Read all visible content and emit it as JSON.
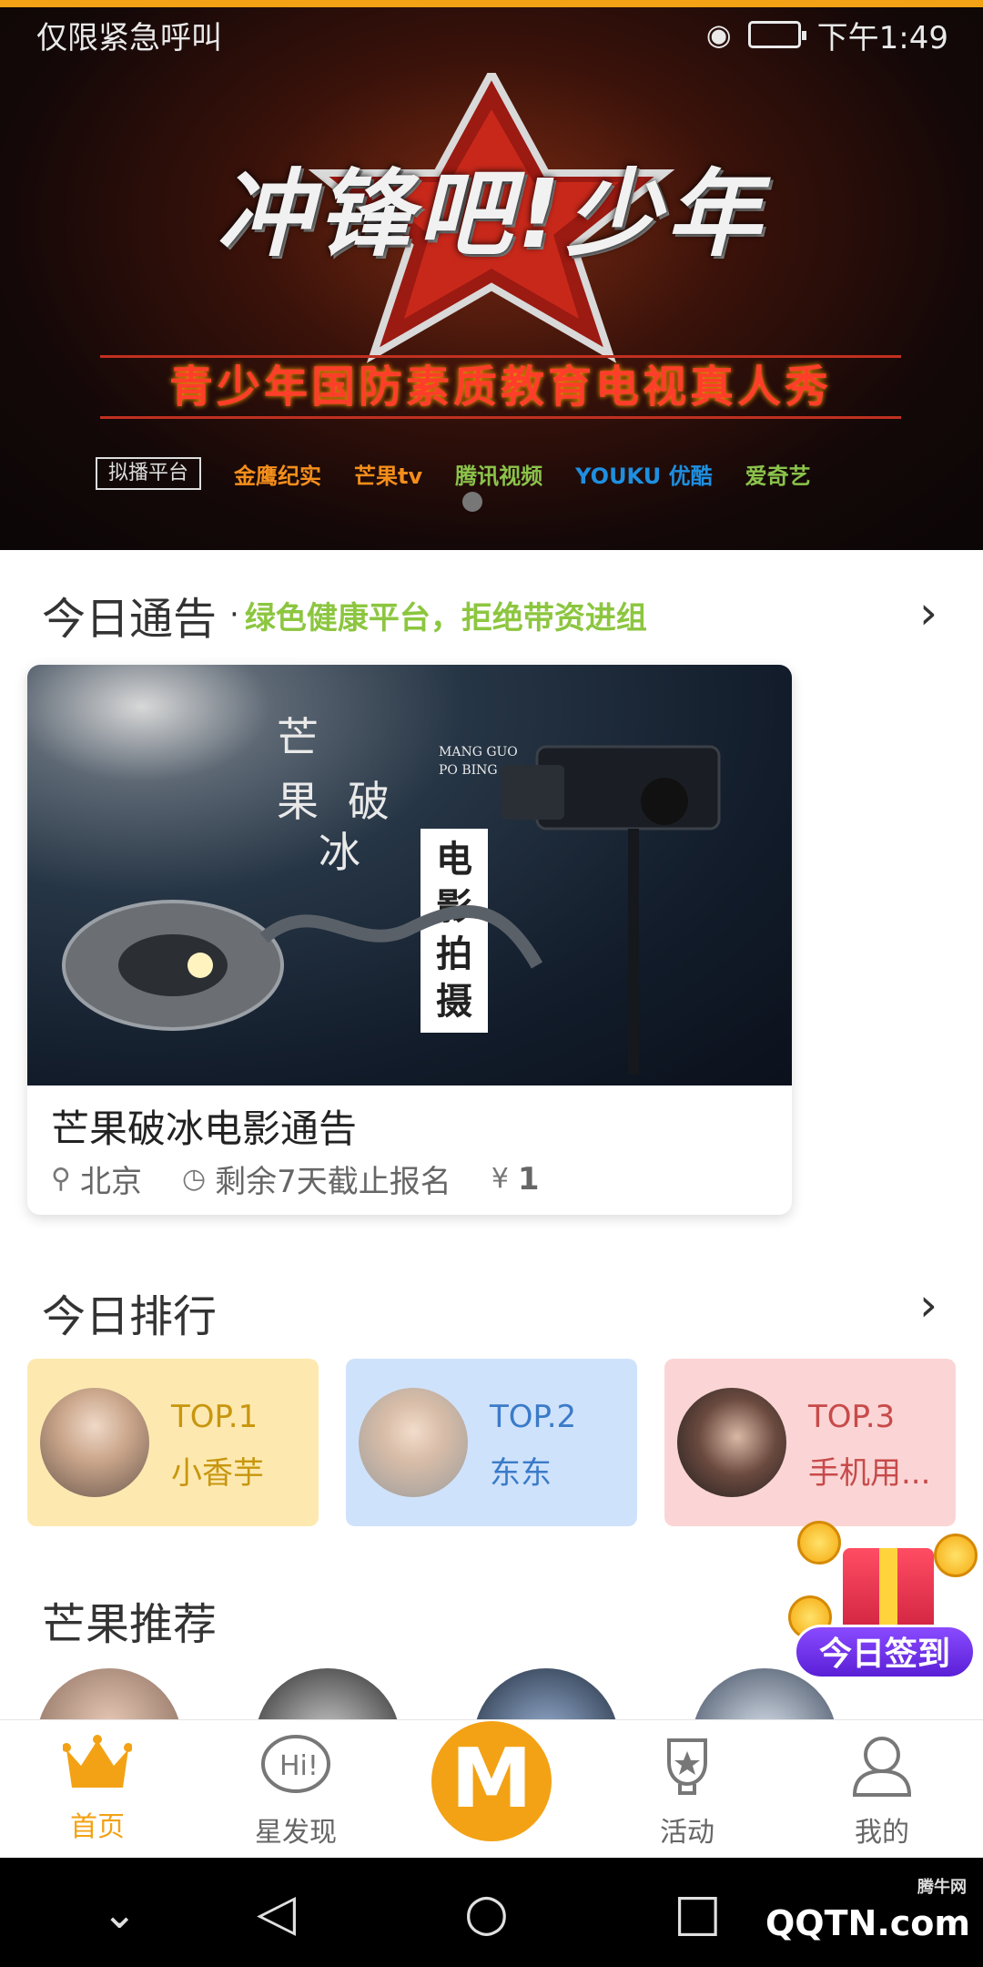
{
  "status_bar": {
    "carrier": "仅限紧急呼叫",
    "time": "下午1:49"
  },
  "banner": {
    "title": "冲锋吧!少年",
    "subtitle": "青少年国防素质教育电视真人秀",
    "logos": [
      "拟播平台",
      "金鹰纪实",
      "芒果tv",
      "腾讯视频",
      "YOUKU 优酷",
      "爱奇艺"
    ]
  },
  "notice": {
    "title": "今日通告",
    "separator": "·",
    "subtitle": "绿色健康平台，拒绝带资进组",
    "card": {
      "cover_words": [
        "芒",
        "果",
        "破",
        "冰"
      ],
      "cover_en": [
        "MANG GUO",
        "PO BING"
      ],
      "cover_vertical": "电影拍摄",
      "title": "芒果破冰电影通告",
      "location": "北京",
      "deadline": "剩余7天截止报名",
      "count": "1"
    }
  },
  "ranking": {
    "title": "今日排行",
    "items": [
      {
        "rank": "TOP.1",
        "name": "小香芋",
        "color": "#c8960e",
        "bg": "#fde9b0"
      },
      {
        "rank": "TOP.2",
        "name": "东东",
        "color": "#3a7bc8",
        "bg": "#cfe2fb"
      },
      {
        "rank": "TOP.3",
        "name": "手机用...",
        "color": "#c84a4a",
        "bg": "#fbd5d5"
      }
    ]
  },
  "recommend": {
    "title": "芒果推荐"
  },
  "gift": {
    "label": "今日签到"
  },
  "tabbar": {
    "items": [
      {
        "label": "首页",
        "icon": "crown-icon"
      },
      {
        "label": "星发现",
        "icon": "hi-bubble-icon"
      },
      {
        "label": "",
        "icon": "mango-logo-icon"
      },
      {
        "label": "活动",
        "icon": "trophy-icon"
      },
      {
        "label": "我的",
        "icon": "user-icon"
      }
    ],
    "center_text": "M"
  },
  "watermark": {
    "text": "QQTN.com",
    "small": "腾牛网"
  },
  "colors": {
    "accent": "#f3a215",
    "green": "#8cc63f"
  }
}
